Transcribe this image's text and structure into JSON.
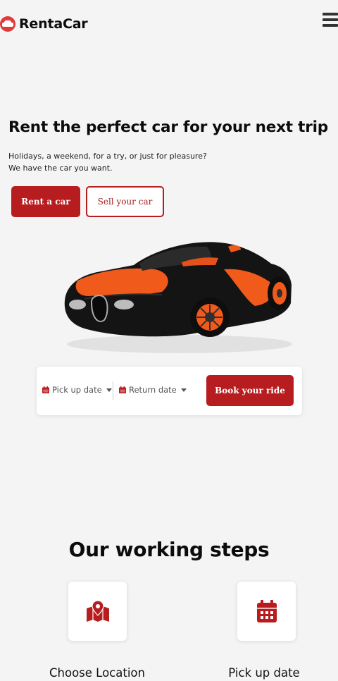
{
  "brand": {
    "name": "RentaCar",
    "accent": "#b71c1f"
  },
  "header": {
    "logo_icon": "car-badge-icon",
    "menu_icon": "hamburger-menu-icon"
  },
  "hero": {
    "title": "Rent the perfect car for your next trip",
    "subtitle_line1": "Holidays, a weekend, for a try, or just for pleasure?",
    "subtitle_line2": "We have the car you want.",
    "primary_button": "Rent a car",
    "secondary_button": "Sell your car"
  },
  "booking": {
    "pickup_label": "Pick up date",
    "return_label": "Return date",
    "book_button": "Book your ride",
    "field_icon": "calendar-icon",
    "dropdown_icon": "caret-down-icon"
  },
  "steps": {
    "title": "Our working steps",
    "items": [
      {
        "label": "Choose Location",
        "icon": "map-pin-icon"
      },
      {
        "label": "Pick up date",
        "icon": "calendar-icon"
      }
    ]
  }
}
